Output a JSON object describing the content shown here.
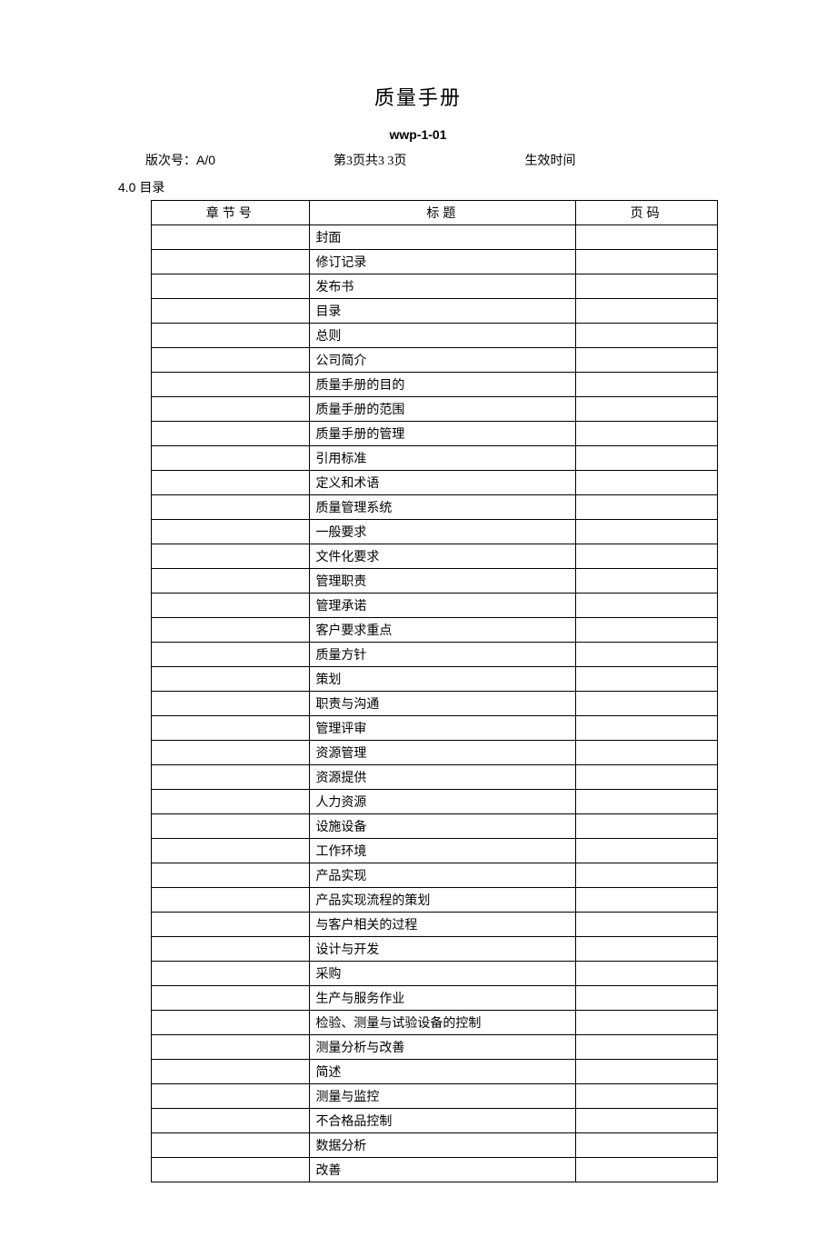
{
  "title": "质量手册",
  "doc_code": "wwp-1-01",
  "meta": {
    "version_label": "版次号：",
    "version_value": "A/0",
    "page_info": "第3页共3 3页",
    "effective_label": "生效时间"
  },
  "section_heading": "4.0 目录",
  "table": {
    "headers": {
      "chapter": "章节号",
      "title": "标题",
      "page": "页码"
    },
    "rows": [
      {
        "chapter": "",
        "title": "封面",
        "page": ""
      },
      {
        "chapter": "",
        "title": "修订记录",
        "page": ""
      },
      {
        "chapter": "",
        "title": "发布书",
        "page": ""
      },
      {
        "chapter": "",
        "title": "目录",
        "page": ""
      },
      {
        "chapter": "",
        "title": "总则",
        "page": ""
      },
      {
        "chapter": "",
        "title": "公司简介",
        "page": ""
      },
      {
        "chapter": "",
        "title": "质量手册的目的",
        "page": ""
      },
      {
        "chapter": "",
        "title": "质量手册的范围",
        "page": ""
      },
      {
        "chapter": "",
        "title": "质量手册的管理",
        "page": ""
      },
      {
        "chapter": "",
        "title": "引用标准",
        "page": ""
      },
      {
        "chapter": "",
        "title": "定义和术语",
        "page": ""
      },
      {
        "chapter": "",
        "title": "质量管理系统",
        "page": ""
      },
      {
        "chapter": "",
        "title": "一般要求",
        "page": ""
      },
      {
        "chapter": "",
        "title": "文件化要求",
        "page": ""
      },
      {
        "chapter": "",
        "title": "管理职责",
        "page": ""
      },
      {
        "chapter": "",
        "title": "管理承诺",
        "page": ""
      },
      {
        "chapter": "",
        "title": "客户要求重点",
        "page": ""
      },
      {
        "chapter": "",
        "title": "质量方针",
        "page": ""
      },
      {
        "chapter": "",
        "title": "策划",
        "page": ""
      },
      {
        "chapter": "",
        "title": "职责与沟通",
        "page": ""
      },
      {
        "chapter": "",
        "title": "管理评审",
        "page": ""
      },
      {
        "chapter": "",
        "title": "资源管理",
        "page": ""
      },
      {
        "chapter": "",
        "title": "资源提供",
        "page": ""
      },
      {
        "chapter": "",
        "title": "人力资源",
        "page": ""
      },
      {
        "chapter": "",
        "title": "设施设备",
        "page": ""
      },
      {
        "chapter": "",
        "title": "工作环境",
        "page": ""
      },
      {
        "chapter": "",
        "title": "产品实现",
        "page": ""
      },
      {
        "chapter": "",
        "title": "产品实现流程的策划",
        "page": ""
      },
      {
        "chapter": "",
        "title": "与客户相关的过程",
        "page": ""
      },
      {
        "chapter": "",
        "title": "设计与开发",
        "page": ""
      },
      {
        "chapter": "",
        "title": "采购",
        "page": ""
      },
      {
        "chapter": "",
        "title": "生产与服务作业",
        "page": ""
      },
      {
        "chapter": "",
        "title": "检验、测量与试验设备的控制",
        "page": ""
      },
      {
        "chapter": "",
        "title": "测量分析与改善",
        "page": ""
      },
      {
        "chapter": "",
        "title": "简述",
        "page": ""
      },
      {
        "chapter": "",
        "title": "测量与监控",
        "page": ""
      },
      {
        "chapter": "",
        "title": "不合格品控制",
        "page": ""
      },
      {
        "chapter": "",
        "title": "数据分析",
        "page": ""
      },
      {
        "chapter": "",
        "title": "改善",
        "page": ""
      }
    ]
  }
}
